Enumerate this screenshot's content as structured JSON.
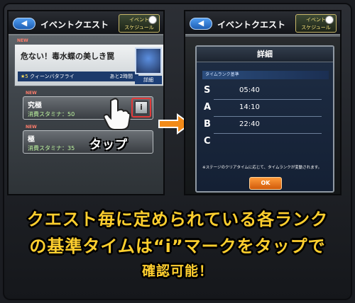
{
  "left_screen": {
    "back_label": "◀",
    "title": "イベントクエスト",
    "schedule_label_1": "イベント",
    "schedule_label_2": "スケジュール",
    "new_tag": "NEW",
    "banner": {
      "title": "危ない！毒水蝶の美しき罠",
      "rarity": "★5",
      "boss_name": "クィーンバタフライ",
      "time_left": "あと2時間",
      "detail_label": "詳細"
    },
    "quests": [
      {
        "name": "究極",
        "stamina": "消費スタミナ：50",
        "info_label": "i"
      },
      {
        "name": "極",
        "stamina": "消費スタミナ：35"
      }
    ],
    "tap_label": "タップ"
  },
  "right_screen": {
    "back_label": "◀",
    "title": "イベントクエスト",
    "schedule_label_1": "イベント",
    "schedule_label_2": "スケジュール",
    "modal": {
      "title": "詳細",
      "section_header": "タイムランク基準",
      "ranks": [
        {
          "letter": "S",
          "time": "05:40"
        },
        {
          "letter": "A",
          "time": "14:10"
        },
        {
          "letter": "B",
          "time": "22:40"
        },
        {
          "letter": "C",
          "time": ""
        }
      ],
      "note": "※ステージのクリアタイムに応じて、タイムランクが変動されます。",
      "ok_label": "OK"
    }
  },
  "caption": {
    "line1": "クエスト毎に定められている各ランク",
    "line2": "の基準タイムは“i”マークをタップで",
    "line3": "確認可能！"
  }
}
